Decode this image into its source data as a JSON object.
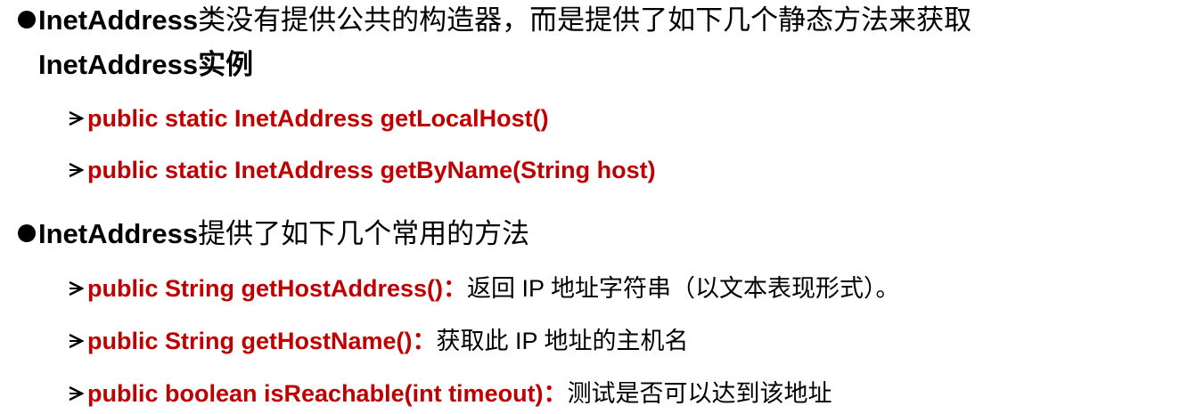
{
  "section1": {
    "title_latin": "InetAddress",
    "title_rest_line1": "类没有提供公共的构造器，而是提供了如下几个静态方法来获取",
    "title_line2": "InetAddress实例",
    "methods": [
      {
        "signature": "public static InetAddress getLocalHost()"
      },
      {
        "signature": "public static InetAddress getByName(String host)"
      }
    ]
  },
  "section2": {
    "title_latin": "InetAddress",
    "title_rest": "提供了如下几个常用的方法",
    "methods": [
      {
        "signature": "public String getHostAddress()：",
        "description": "返回 IP 地址字符串（以文本表现形式）。"
      },
      {
        "signature": "public String getHostName()：",
        "description": "获取此 IP 地址的主机名"
      },
      {
        "signature": "public boolean isReachable(int timeout)：",
        "description": "测试是否可以达到该地址"
      }
    ]
  },
  "colors": {
    "code": "#c00000",
    "text": "#000000",
    "background": "#ffffff"
  },
  "icons": {
    "bullet": "filled-circle",
    "sub_bullet": "open-arrowhead"
  }
}
